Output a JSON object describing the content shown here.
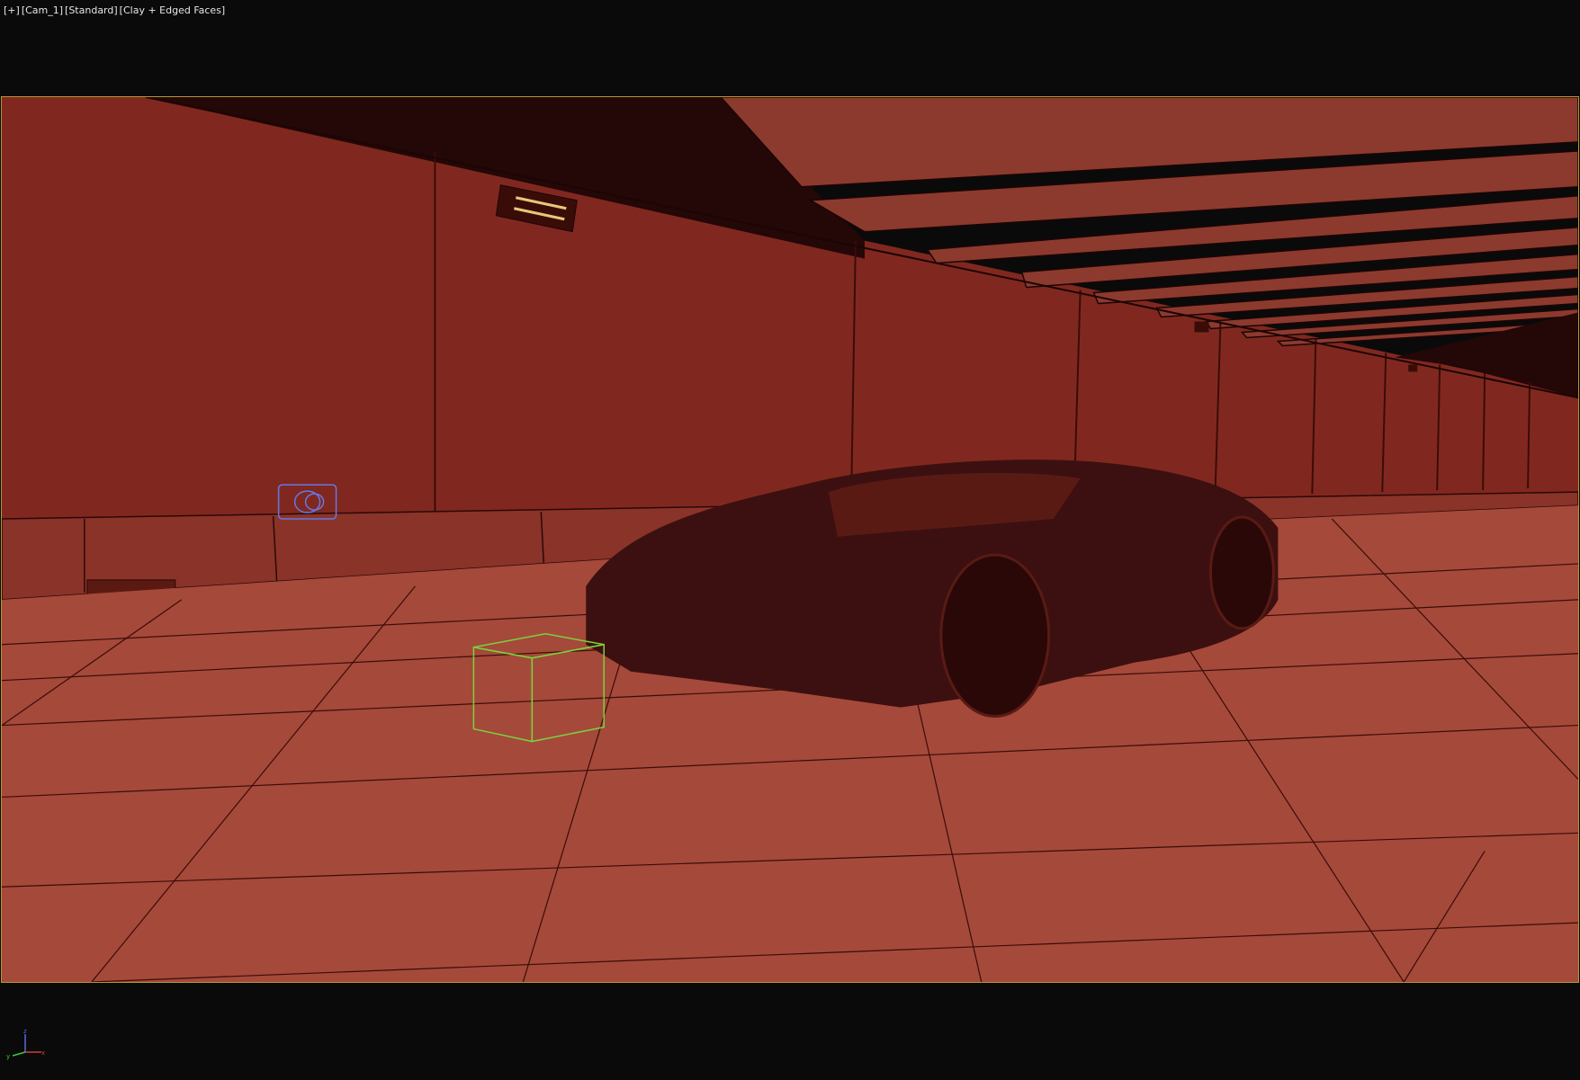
{
  "viewport": {
    "menu_label": "[+]",
    "camera_label": "[Cam_1]",
    "shading_mode_label": "[Standard]",
    "display_mode_label": "[Clay + Edged Faces]"
  },
  "colors": {
    "background": "#0a0a0a",
    "safe_frame": "#b49632",
    "clay_floor": "#a5493a",
    "clay_wall": "#80281f",
    "clay_ceiling": "#8c3a2e",
    "shadow": "#2a0808",
    "car_body": "#3c1010",
    "selection_box": "#7ad23c",
    "light_helper": "#6478e6"
  },
  "gizmo": {
    "x_label": "x",
    "y_label": "y",
    "z_label": "z"
  }
}
